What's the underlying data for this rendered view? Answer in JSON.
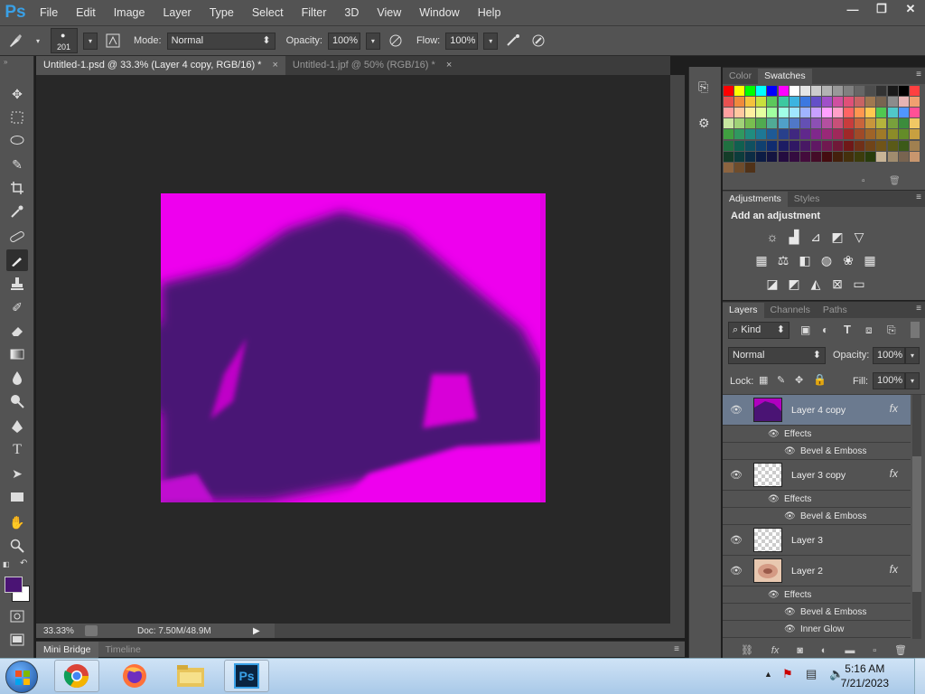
{
  "app": {
    "logo": "Ps",
    "accent": "#39a0e6"
  },
  "menu": [
    "File",
    "Edit",
    "Image",
    "Layer",
    "Type",
    "Select",
    "Filter",
    "3D",
    "View",
    "Window",
    "Help"
  ],
  "window_controls": {
    "minimize": "—",
    "restore": "❐",
    "close": "✕"
  },
  "options": {
    "brush_size": "201",
    "mode_label": "Mode:",
    "mode_value": "Normal",
    "opacity_label": "Opacity:",
    "opacity_value": "100%",
    "flow_label": "Flow:",
    "flow_value": "100%"
  },
  "tabs": [
    {
      "label": "Untitled-1.psd @ 33.3% (Layer 4 copy, RGB/16) *",
      "close": "×"
    },
    {
      "label": "Untitled-1.jpf @ 50% (RGB/16) *",
      "close": "×"
    }
  ],
  "status": {
    "zoom": "33.33%",
    "doc": "Doc: 7.50M/48.9M"
  },
  "bottom_tabs": [
    "Mini Bridge",
    "Timeline"
  ],
  "colors": {
    "foreground": "#4a1474",
    "background": "#ffffff",
    "doc_magenta": "#ee00ee",
    "doc_purple": "#4a1474"
  },
  "color_panel": {
    "tabs": [
      "Color",
      "Swatches"
    ]
  },
  "adjustments": {
    "tabs": [
      "Adjustments",
      "Styles"
    ],
    "title": "Add an adjustment"
  },
  "layers_panel": {
    "tabs": [
      "Layers",
      "Channels",
      "Paths"
    ],
    "filter_kind": "Kind",
    "blend_mode": "Normal",
    "opacity_label": "Opacity:",
    "opacity_value": "100%",
    "lock_label": "Lock:",
    "fill_label": "Fill:",
    "fill_value": "100%",
    "fx_label": "fx",
    "layers": [
      {
        "name": "Layer 4 copy",
        "effects_label": "Effects",
        "effects": [
          "Bevel & Emboss"
        ]
      },
      {
        "name": "Layer 3 copy",
        "effects_label": "Effects",
        "effects": [
          "Bevel & Emboss"
        ]
      },
      {
        "name": "Layer 3"
      },
      {
        "name": "Layer 2",
        "effects_label": "Effects",
        "effects": [
          "Bevel & Emboss",
          "Inner Glow"
        ]
      }
    ]
  },
  "taskbar": {
    "time": "5:16 AM",
    "date": "7/21/2023"
  }
}
